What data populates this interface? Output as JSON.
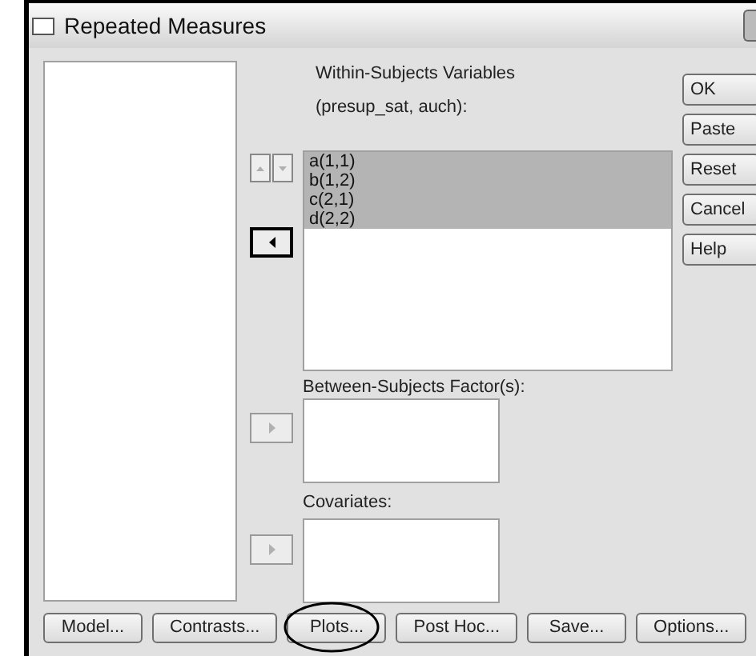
{
  "window": {
    "title": "Repeated Measures"
  },
  "within_subjects": {
    "label": "Within-Subjects Variables",
    "sublabel": "(presup_sat, auch):",
    "items": [
      {
        "label": "a(1,1)",
        "selected": true
      },
      {
        "label": "b(1,2)",
        "selected": true
      },
      {
        "label": "c(2,1)",
        "selected": true
      },
      {
        "label": "d(2,2)",
        "selected": true
      }
    ]
  },
  "move_buttons": [
    {
      "kind": "updown",
      "disabled": true
    },
    {
      "kind": "left",
      "disabled": false
    },
    {
      "kind": "right",
      "disabled": true
    },
    {
      "kind": "right",
      "disabled": true
    }
  ],
  "between_subjects": {
    "label": "Between-Subjects Factor(s):"
  },
  "covariates": {
    "label": "Covariates:"
  },
  "side_buttons": [
    "OK",
    "Paste",
    "Reset",
    "Cancel",
    "Help"
  ],
  "bottom_buttons": [
    {
      "label": "Model...",
      "circled": false
    },
    {
      "label": "Contrasts...",
      "circled": false
    },
    {
      "label": "Plots...",
      "circled": true
    },
    {
      "label": "Post Hoc...",
      "circled": false
    },
    {
      "label": "Save...",
      "circled": false
    },
    {
      "label": "Options...",
      "circled": false
    }
  ]
}
